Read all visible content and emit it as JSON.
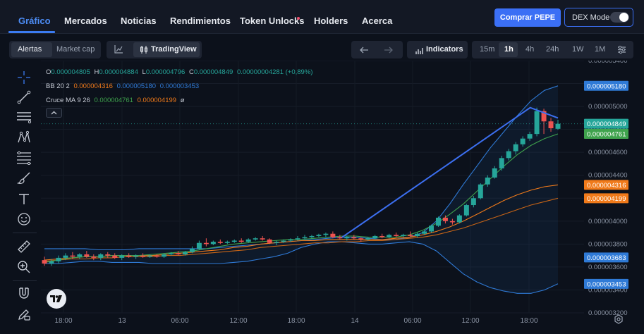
{
  "nav": {
    "tabs": [
      "Gráfico",
      "Mercados",
      "Noticias",
      "Rendimientos",
      "Token Unlocks",
      "Holders",
      "Acerca"
    ],
    "buy_label": "Comprar PEPE",
    "dex_label": "DEX Mode"
  },
  "toolbar": {
    "alerts": "Alertas",
    "market_cap": "Market cap",
    "tradingview": "TradingView",
    "indicators": "Indicators",
    "timeframes": [
      "15m",
      "1h",
      "4h",
      "24h",
      "1W",
      "1M"
    ],
    "active_timeframe": "1h"
  },
  "tools": [
    "crosshair-icon",
    "trend-line-icon",
    "horizontal-lines-icon",
    "pattern-icon",
    "fib-icon",
    "brush-icon",
    "text-icon",
    "emoji-icon",
    "ruler-icon",
    "zoom-in-icon",
    "magnet-icon",
    "lock-pencil-icon"
  ],
  "legend": {
    "ohlc": {
      "o_label": "O",
      "o": "0.000004805",
      "h_label": "H",
      "h": "0.000004884",
      "l_label": "L",
      "l": "0.000004796",
      "c_label": "C",
      "c": "0.000004849",
      "change": "0.00000004281 (+0,89%)"
    },
    "bb": {
      "label": "BB 20 2",
      "v1": "0.000004316",
      "v2": "0.000005180",
      "v3": "0.000003453"
    },
    "ma": {
      "label": "Cruce MA 9 26",
      "v1": "0.000004761",
      "v2": "0.000004199",
      "symbol": "ø"
    }
  },
  "colors": {
    "up": "#26a69a",
    "down": "#ef5350",
    "bb": "#2f7ad6",
    "ma_fast": "#3fa34d",
    "ma_slow": "#f07a1a",
    "trend": "#3c6ff0",
    "accent": "#3b6ff5"
  },
  "chart_data": {
    "type": "candlestick",
    "y_axis": {
      "ticks": [
        "0.000005400",
        "0.000005200",
        "0.000005000",
        "0.000004800",
        "0.000004600",
        "0.000004400",
        "0.000004200",
        "0.000004000",
        "0.000003800",
        "0.000003600",
        "0.000003400",
        "0.000003200"
      ],
      "range": [
        3.2e-06,
        5.4e-06
      ]
    },
    "x_axis": {
      "labels": [
        "18:00",
        "13",
        "06:00",
        "12:00",
        "18:00",
        "14",
        "06:00",
        "12:00",
        "18:00"
      ]
    },
    "price_tags": [
      {
        "label": "0.000005180",
        "value": 5.18e-06,
        "color": "#2f7ad6"
      },
      {
        "label": "0.000004849",
        "value": 4.849e-06,
        "color": "#26a69a"
      },
      {
        "label": "0.000004761",
        "value": 4.761e-06,
        "color": "#3fa34d"
      },
      {
        "label": "0.000004316",
        "value": 4.316e-06,
        "color": "#f07a1a"
      },
      {
        "label": "0.000004199",
        "value": 4.199e-06,
        "color": "#f07a1a"
      },
      {
        "label": "0.000003683",
        "value": 3.683e-06,
        "color": "#2f7ad6"
      },
      {
        "label": "0.000003453",
        "value": 3.453e-06,
        "color": "#2f7ad6"
      }
    ],
    "candles": [
      {
        "o": 3.66,
        "h": 3.69,
        "l": 3.61,
        "c": 3.63
      },
      {
        "o": 3.63,
        "h": 3.67,
        "l": 3.61,
        "c": 3.65
      },
      {
        "o": 3.65,
        "h": 3.7,
        "l": 3.63,
        "c": 3.68
      },
      {
        "o": 3.68,
        "h": 3.72,
        "l": 3.66,
        "c": 3.7
      },
      {
        "o": 3.7,
        "h": 3.73,
        "l": 3.67,
        "c": 3.69
      },
      {
        "o": 3.69,
        "h": 3.72,
        "l": 3.67,
        "c": 3.71
      },
      {
        "o": 3.71,
        "h": 3.74,
        "l": 3.68,
        "c": 3.69
      },
      {
        "o": 3.69,
        "h": 3.71,
        "l": 3.66,
        "c": 3.68
      },
      {
        "o": 3.68,
        "h": 3.72,
        "l": 3.66,
        "c": 3.71
      },
      {
        "o": 3.71,
        "h": 3.73,
        "l": 3.68,
        "c": 3.7
      },
      {
        "o": 3.7,
        "h": 3.72,
        "l": 3.67,
        "c": 3.68
      },
      {
        "o": 3.68,
        "h": 3.71,
        "l": 3.66,
        "c": 3.7
      },
      {
        "o": 3.7,
        "h": 3.72,
        "l": 3.68,
        "c": 3.69
      },
      {
        "o": 3.69,
        "h": 3.71,
        "l": 3.67,
        "c": 3.7
      },
      {
        "o": 3.7,
        "h": 3.72,
        "l": 3.68,
        "c": 3.69
      },
      {
        "o": 3.69,
        "h": 3.71,
        "l": 3.68,
        "c": 3.7
      },
      {
        "o": 3.7,
        "h": 3.71,
        "l": 3.68,
        "c": 3.69
      },
      {
        "o": 3.69,
        "h": 3.72,
        "l": 3.68,
        "c": 3.71
      },
      {
        "o": 3.71,
        "h": 3.73,
        "l": 3.7,
        "c": 3.72
      },
      {
        "o": 3.72,
        "h": 3.74,
        "l": 3.7,
        "c": 3.71
      },
      {
        "o": 3.71,
        "h": 3.74,
        "l": 3.7,
        "c": 3.73
      },
      {
        "o": 3.73,
        "h": 3.78,
        "l": 3.72,
        "c": 3.76
      },
      {
        "o": 3.76,
        "h": 3.83,
        "l": 3.75,
        "c": 3.81
      },
      {
        "o": 3.81,
        "h": 3.85,
        "l": 3.78,
        "c": 3.8
      },
      {
        "o": 3.8,
        "h": 3.83,
        "l": 3.79,
        "c": 3.82
      },
      {
        "o": 3.82,
        "h": 3.84,
        "l": 3.8,
        "c": 3.81
      },
      {
        "o": 3.81,
        "h": 3.83,
        "l": 3.8,
        "c": 3.82
      },
      {
        "o": 3.82,
        "h": 3.84,
        "l": 3.81,
        "c": 3.83
      },
      {
        "o": 3.83,
        "h": 3.85,
        "l": 3.81,
        "c": 3.82
      },
      {
        "o": 3.82,
        "h": 3.85,
        "l": 3.81,
        "c": 3.84
      },
      {
        "o": 3.84,
        "h": 3.86,
        "l": 3.83,
        "c": 3.85
      },
      {
        "o": 3.85,
        "h": 3.87,
        "l": 3.83,
        "c": 3.84
      },
      {
        "o": 3.84,
        "h": 3.85,
        "l": 3.8,
        "c": 3.81
      },
      {
        "o": 3.81,
        "h": 3.83,
        "l": 3.79,
        "c": 3.82
      },
      {
        "o": 3.82,
        "h": 3.84,
        "l": 3.81,
        "c": 3.83
      },
      {
        "o": 3.83,
        "h": 3.85,
        "l": 3.82,
        "c": 3.84
      },
      {
        "o": 3.84,
        "h": 3.87,
        "l": 3.83,
        "c": 3.85
      },
      {
        "o": 3.85,
        "h": 3.88,
        "l": 3.84,
        "c": 3.86
      },
      {
        "o": 3.86,
        "h": 3.88,
        "l": 3.85,
        "c": 3.87
      },
      {
        "o": 3.87,
        "h": 3.89,
        "l": 3.86,
        "c": 3.88
      },
      {
        "o": 3.88,
        "h": 3.9,
        "l": 3.86,
        "c": 3.89
      },
      {
        "o": 3.89,
        "h": 3.91,
        "l": 3.85,
        "c": 3.86
      },
      {
        "o": 3.86,
        "h": 3.88,
        "l": 3.84,
        "c": 3.85
      },
      {
        "o": 3.85,
        "h": 3.87,
        "l": 3.83,
        "c": 3.86
      },
      {
        "o": 3.86,
        "h": 3.88,
        "l": 3.84,
        "c": 3.85
      },
      {
        "o": 3.85,
        "h": 3.86,
        "l": 3.82,
        "c": 3.84
      },
      {
        "o": 3.84,
        "h": 3.86,
        "l": 3.83,
        "c": 3.85
      },
      {
        "o": 3.85,
        "h": 3.88,
        "l": 3.84,
        "c": 3.87
      },
      {
        "o": 3.87,
        "h": 3.89,
        "l": 3.85,
        "c": 3.86
      },
      {
        "o": 3.86,
        "h": 3.89,
        "l": 3.85,
        "c": 3.88
      },
      {
        "o": 3.88,
        "h": 3.9,
        "l": 3.86,
        "c": 3.87
      },
      {
        "o": 3.87,
        "h": 3.89,
        "l": 3.86,
        "c": 3.88
      },
      {
        "o": 3.88,
        "h": 3.91,
        "l": 3.86,
        "c": 3.87
      },
      {
        "o": 3.87,
        "h": 3.9,
        "l": 3.86,
        "c": 3.89
      },
      {
        "o": 3.89,
        "h": 3.92,
        "l": 3.88,
        "c": 3.91
      },
      {
        "o": 3.91,
        "h": 3.97,
        "l": 3.9,
        "c": 3.96
      },
      {
        "o": 3.96,
        "h": 4.04,
        "l": 3.95,
        "c": 4.03
      },
      {
        "o": 4.03,
        "h": 4.05,
        "l": 3.98,
        "c": 4.0
      },
      {
        "o": 4.0,
        "h": 4.02,
        "l": 3.97,
        "c": 3.99
      },
      {
        "o": 3.99,
        "h": 4.06,
        "l": 3.98,
        "c": 4.05
      },
      {
        "o": 4.05,
        "h": 4.15,
        "l": 4.04,
        "c": 4.14
      },
      {
        "o": 4.14,
        "h": 4.22,
        "l": 4.12,
        "c": 4.2
      },
      {
        "o": 4.2,
        "h": 4.33,
        "l": 4.19,
        "c": 4.32
      },
      {
        "o": 4.32,
        "h": 4.4,
        "l": 4.3,
        "c": 4.38
      },
      {
        "o": 4.38,
        "h": 4.48,
        "l": 4.37,
        "c": 4.46
      },
      {
        "o": 4.46,
        "h": 4.57,
        "l": 4.44,
        "c": 4.55
      },
      {
        "o": 4.55,
        "h": 4.63,
        "l": 4.53,
        "c": 4.61
      },
      {
        "o": 4.61,
        "h": 4.69,
        "l": 4.58,
        "c": 4.67
      },
      {
        "o": 4.67,
        "h": 4.74,
        "l": 4.65,
        "c": 4.72
      },
      {
        "o": 4.72,
        "h": 4.78,
        "l": 4.7,
        "c": 4.76
      },
      {
        "o": 4.76,
        "h": 4.99,
        "l": 4.74,
        "c": 4.96
      },
      {
        "o": 4.96,
        "h": 4.98,
        "l": 4.76,
        "c": 4.87
      },
      {
        "o": 4.87,
        "h": 4.9,
        "l": 4.78,
        "c": 4.81
      },
      {
        "o": 4.805,
        "h": 4.884,
        "l": 4.796,
        "c": 4.849
      }
    ],
    "price_unit_note": "candle values are in 1e-6 units",
    "bollinger": {
      "upper": [
        3.76,
        3.76,
        3.76,
        3.76,
        3.75,
        3.75,
        3.75,
        3.76,
        3.76,
        3.76,
        3.76,
        3.76,
        3.76,
        3.77,
        3.78,
        3.79,
        3.8,
        3.81,
        3.82,
        3.83,
        3.84,
        3.85,
        3.86,
        3.86,
        3.85,
        3.84,
        3.84,
        3.86,
        3.9,
        4.0,
        4.15,
        4.32,
        4.48,
        4.64,
        4.78,
        4.92,
        5.05,
        5.14,
        5.18
      ],
      "middle": [
        3.66,
        3.67,
        3.68,
        3.69,
        3.69,
        3.7,
        3.7,
        3.7,
        3.7,
        3.71,
        3.72,
        3.73,
        3.74,
        3.75,
        3.77,
        3.78,
        3.8,
        3.81,
        3.82,
        3.83,
        3.83,
        3.84,
        3.84,
        3.84,
        3.84,
        3.84,
        3.85,
        3.86,
        3.88,
        3.91,
        3.95,
        4.0,
        4.06,
        4.12,
        4.18,
        4.23,
        4.27,
        4.3,
        4.316
      ],
      "lower": [
        3.63,
        3.63,
        3.64,
        3.65,
        3.65,
        3.64,
        3.64,
        3.64,
        3.63,
        3.63,
        3.63,
        3.63,
        3.63,
        3.63,
        3.64,
        3.65,
        3.67,
        3.69,
        3.72,
        3.77,
        3.8,
        3.82,
        3.82,
        3.81,
        3.8,
        3.8,
        3.81,
        3.82,
        3.8,
        3.74,
        3.64,
        3.54,
        3.47,
        3.42,
        3.39,
        3.37,
        3.37,
        3.4,
        3.453
      ]
    },
    "ma_fast": [
      3.64,
      3.66,
      3.68,
      3.69,
      3.69,
      3.7,
      3.7,
      3.7,
      3.71,
      3.72,
      3.73,
      3.74,
      3.76,
      3.78,
      3.8,
      3.81,
      3.82,
      3.83,
      3.84,
      3.84,
      3.85,
      3.86,
      3.87,
      3.87,
      3.86,
      3.86,
      3.86,
      3.88,
      3.92,
      3.98,
      4.06,
      4.15,
      4.26,
      4.37,
      4.48,
      4.58,
      4.66,
      4.72,
      4.761
    ],
    "ma_slow": [
      3.65,
      3.66,
      3.67,
      3.67,
      3.68,
      3.68,
      3.69,
      3.69,
      3.69,
      3.7,
      3.7,
      3.71,
      3.72,
      3.73,
      3.74,
      3.75,
      3.77,
      3.78,
      3.79,
      3.8,
      3.81,
      3.81,
      3.82,
      3.82,
      3.83,
      3.83,
      3.84,
      3.85,
      3.86,
      3.88,
      3.91,
      3.94,
      3.98,
      4.02,
      4.06,
      4.1,
      4.14,
      4.17,
      4.199
    ],
    "trend_line": [
      [
        3.86,
        0.58
      ],
      [
        4.99,
        0.946
      ],
      [
        4.9,
        1.0
      ]
    ]
  }
}
